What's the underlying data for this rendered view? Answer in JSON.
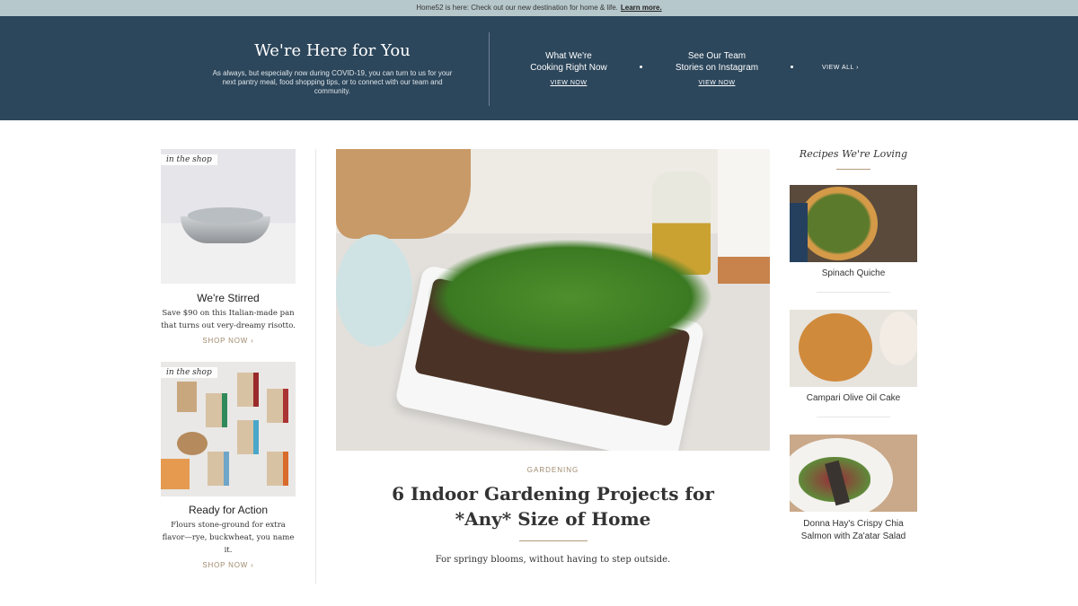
{
  "announcement": {
    "text": "Home52 is here: Check out our new destination for home & life.",
    "link": "Learn more."
  },
  "banner": {
    "title": "We're Here for You",
    "description": "As always, but especially now during COVID-19, you can turn to us for your next pantry meal, food shopping tips, or to connect with our team and community.",
    "links": [
      {
        "line1": "What We're",
        "line2": "Cooking Right Now",
        "cta": "VIEW NOW"
      },
      {
        "line1": "See Our Team",
        "line2": "Stories on Instagram",
        "cta": "VIEW NOW"
      }
    ],
    "view_all": "VIEW ALL"
  },
  "shop": [
    {
      "tag": "in the shop",
      "title": "We're Stirred",
      "description": "Save $90 on this Italian-made pan that turns out very-dreamy risotto.",
      "cta": "SHOP NOW"
    },
    {
      "tag": "in the shop",
      "title": "Ready for Action",
      "description": "Flours stone-ground for extra flavor—rye, buckwheat, you name it.",
      "cta": "SHOP NOW"
    }
  ],
  "feature": {
    "category": "GARDENING",
    "title": "6 Indoor Gardening Projects for *Any* Size of Home",
    "subtitle": "For springy blooms, without having to step outside."
  },
  "recipes": {
    "heading": "Recipes We're Loving",
    "items": [
      "Spinach Quiche",
      "Campari Olive Oil Cake",
      "Donna Hay's Crispy Chia Salmon with Za'atar Salad"
    ]
  },
  "colors": {
    "banner": "#2c465b",
    "topbar": "#b7c8cc",
    "accent": "#a08a6d"
  }
}
